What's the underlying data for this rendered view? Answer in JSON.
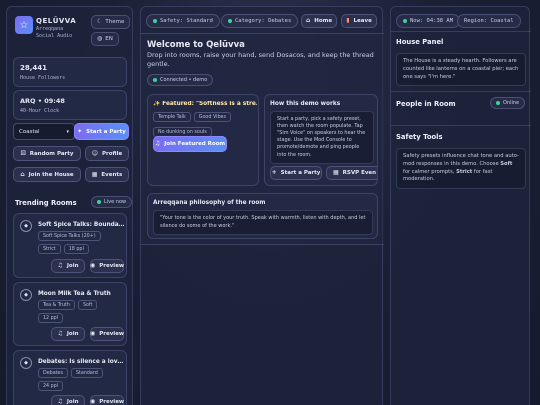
{
  "app": {
    "name": "QELŪVVA",
    "subtitle_line1": "Arreqqana",
    "subtitle_line2": "Social Audio",
    "theme_label": "Theme",
    "lang_label": "EN"
  },
  "stats": {
    "followers_value": "28,441",
    "followers_label": "House Followers",
    "clock_value": "ARQ • 09:48",
    "clock_label": "40-Hour Clock"
  },
  "controls": {
    "region_select": "Coastal",
    "start_party": "Start a Party",
    "random_party": "Random Party",
    "profile": "Profile",
    "join_house": "Join the House",
    "events": "Events"
  },
  "trending": {
    "title": "Trending Rooms",
    "live_label": "Live now",
    "join_label": "Join",
    "preview_label": "Preview",
    "rooms": [
      {
        "title": "Soft Spice Talks: Bounda…",
        "tags": [
          "Soft Spice Talks (20+)",
          "Strict",
          "18 ppl"
        ]
      },
      {
        "title": "Moon Milk Tea & Truth",
        "tags": [
          "Tea & Truth",
          "Soft",
          "12 ppl"
        ]
      },
      {
        "title": "Debates: Is silence a lov…",
        "tags": [
          "Debates",
          "Standard",
          "24 ppl"
        ]
      }
    ]
  },
  "topbar": {
    "safety": "Safety: Standard",
    "category": "Category: Debates",
    "home": "Home",
    "leave": "Leave"
  },
  "main": {
    "welcome_title": "Welcome to Qelūvva",
    "welcome_text": "Drop into rooms, raise your hand, send Dosacos, and keep the thread gentle.",
    "connected": "Connected • demo",
    "featured_title": "✨ Featured: \"Softness is a stre…",
    "featured_tags": [
      "Temple Talk",
      "Good Vibes",
      "No dunking on souls"
    ],
    "join_featured": "Join Featured Room",
    "how_title": "How this demo works",
    "how_text": "Start a party, pick a safety preset, then watch the room populate. Tap \"Sim Voice\" on speakers to hear the stage. Use the Mod Console to promote/demote and ping people into the room.",
    "start_party": "Start a Party",
    "rsvp": "RSVP Even",
    "philosophy_title": "Arreqqana philosophy of the room",
    "philosophy_text": "\"Your tone is the color of your truth. Speak with warmth, listen with depth, and let silence do some of the work.\""
  },
  "right": {
    "now_label": "Now: 04:38 AM",
    "region_label": "Region: Coastal",
    "house_panel_title": "House Panel",
    "house_panel_text": "The House is a steady hearth. Followers are counted like lanterns on a coastal pier; each one says \"I'm here.\"",
    "people_title": "People in Room",
    "online_label": "Online",
    "safety_title": "Safety Tools",
    "safety_text_before": "Safety presets influence chat tone and auto-mod responses in this demo. Choose ",
    "safety_soft": "Soft",
    "safety_text_mid": " for calmer prompts, ",
    "safety_strict": "Strict",
    "safety_text_after": " for fast moderation."
  },
  "icons": {
    "logo": "star-badge-icon",
    "accent": "#7a6cf0",
    "online": "#38d39f"
  }
}
